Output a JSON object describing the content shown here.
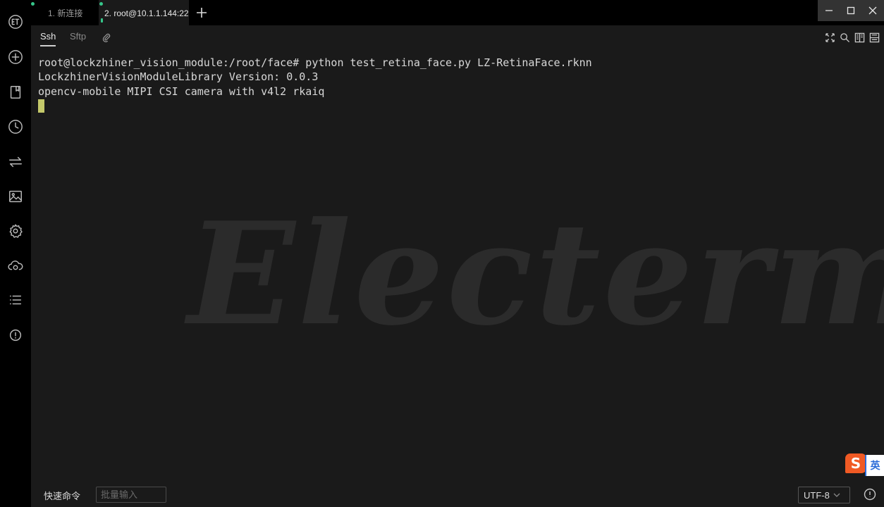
{
  "tabs": [
    {
      "label": "1. 新连接"
    },
    {
      "label": "2. root@10.1.1.144:22"
    }
  ],
  "subtabs": {
    "ssh": "Ssh",
    "sftp": "Sftp"
  },
  "terminal": {
    "lines": [
      "root@lockzhiner_vision_module:/root/face# python test_retina_face.py LZ-RetinaFace.rknn",
      "LockzhinerVisionModuleLibrary Version: 0.0.3",
      "opencv-mobile MIPI CSI camera with v4l2 rkaiq"
    ],
    "watermark": "Electerm"
  },
  "footer": {
    "quick_command_label": "快速命令",
    "batch_input_placeholder": "批量输入",
    "encoding": "UTF-8"
  },
  "ime": {
    "logo": "S",
    "language": "英"
  },
  "colors": {
    "panel_bg": "#1a1a1a",
    "sidebar_bg": "#000000",
    "cursor": "#c4c96a",
    "tab_dot": "#36c68a",
    "ime_orange": "#f05a24",
    "ime_blue": "#2a6bd8"
  }
}
